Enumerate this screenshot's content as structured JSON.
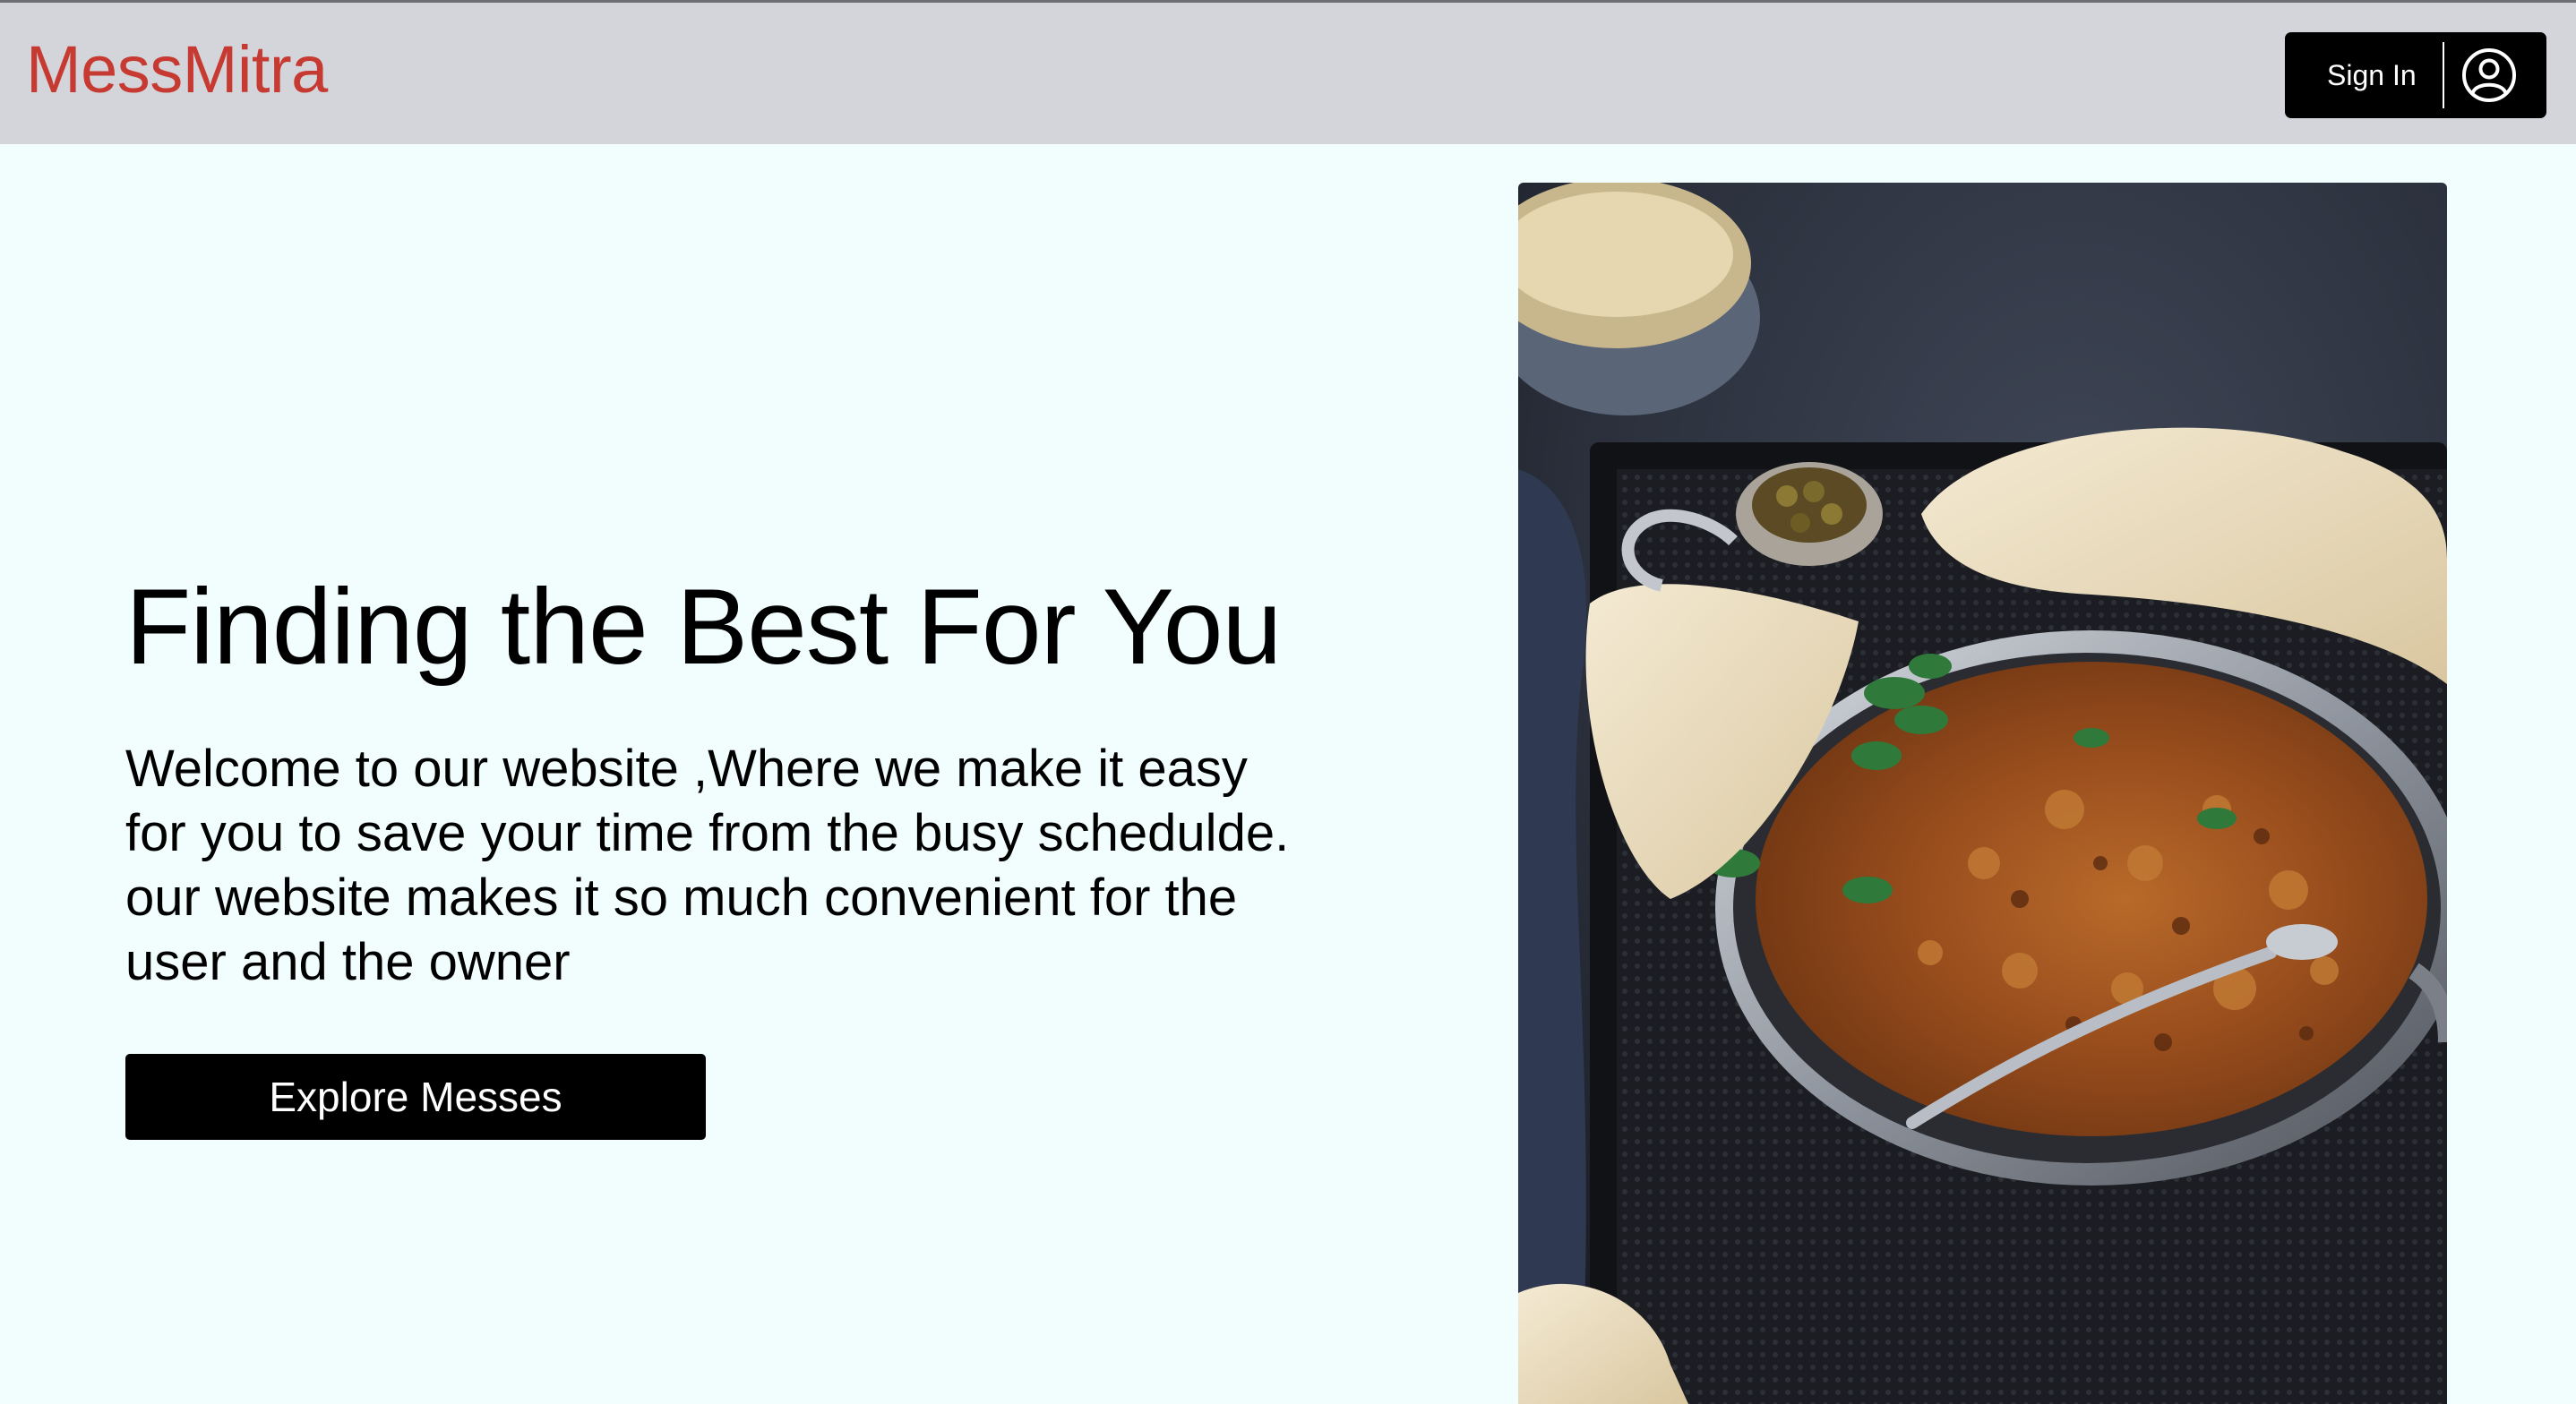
{
  "header": {
    "logo": "MessMitra",
    "signin_label": "Sign In"
  },
  "hero": {
    "title": "Finding the Best For You",
    "description": "Welcome to our website ,Where we make it easy for you to save your time from the busy schedulde. our website makes it so much convenient for the user and the owner",
    "cta_label": "Explore Messes"
  },
  "colors": {
    "header_bg": "#d3d5da",
    "page_bg": "#f1fefd",
    "brand_red": "#c63a32",
    "button_bg": "#000000"
  },
  "icons": {
    "account": "user-circle-icon"
  }
}
